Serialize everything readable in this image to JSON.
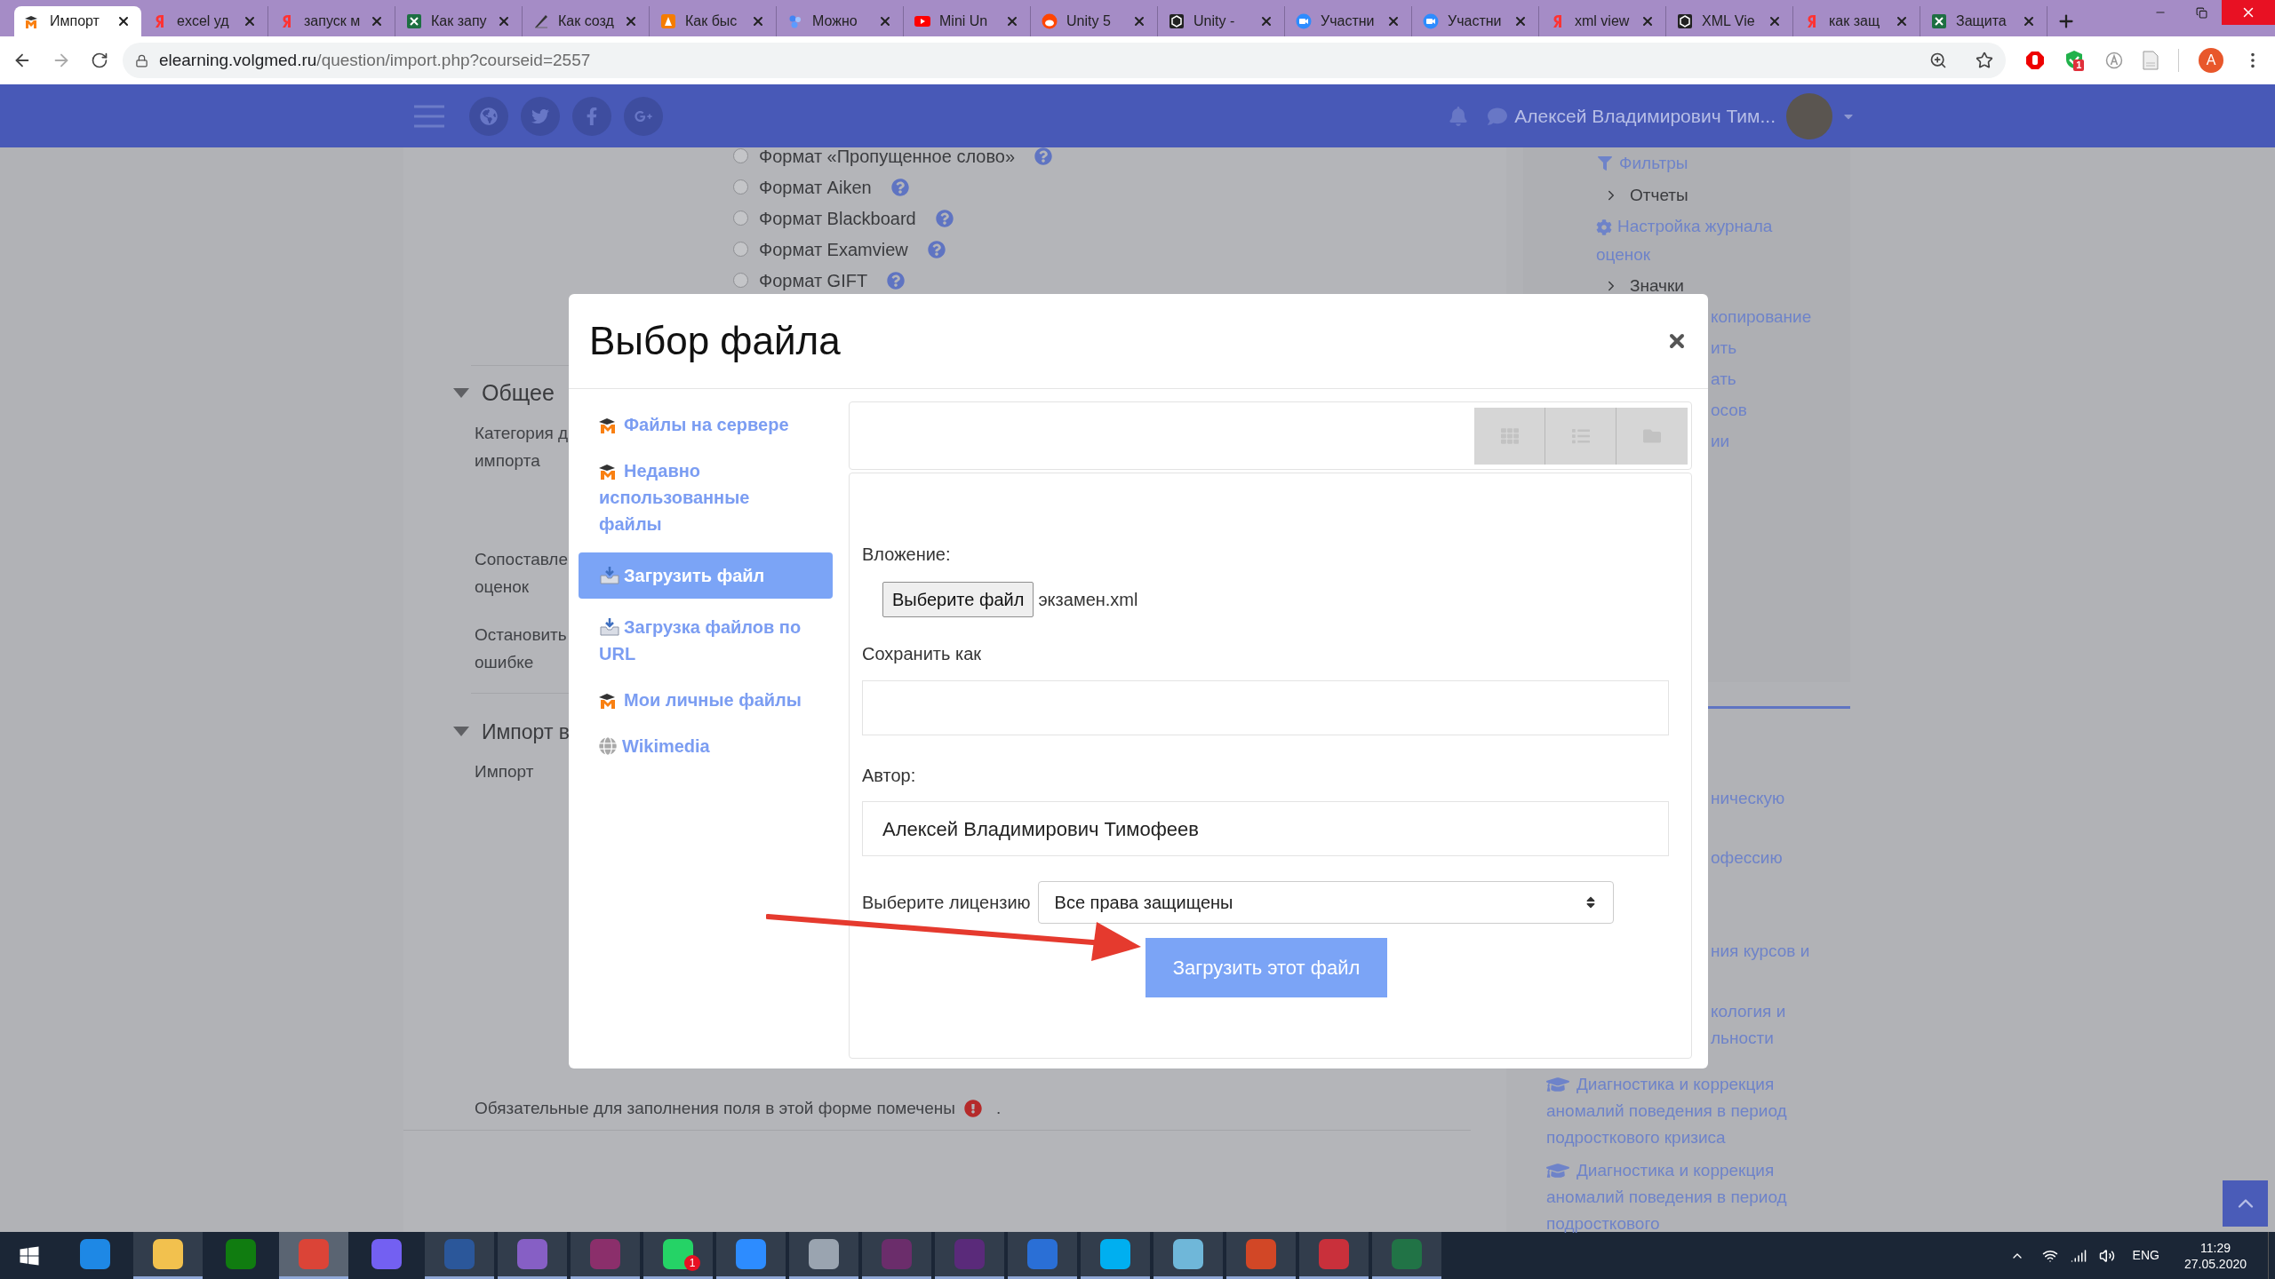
{
  "browser": {
    "tabs": [
      {
        "title": "Импорт",
        "kind": "cap",
        "selected": true
      },
      {
        "title": "excel уд",
        "kind": "letter",
        "selected": false
      },
      {
        "title": "запуск м",
        "kind": "letter",
        "selected": false
      },
      {
        "title": "Как запу",
        "kind": "sheet",
        "selected": false
      },
      {
        "title": "Как созд",
        "kind": "pen",
        "selected": false
      },
      {
        "title": "Как быс",
        "kind": "triangle",
        "selected": false
      },
      {
        "title": "Можно",
        "kind": "dots",
        "selected": false
      },
      {
        "title": "Mini Un",
        "kind": "play",
        "selected": false
      },
      {
        "title": "Unity 5",
        "kind": "alien",
        "selected": false
      },
      {
        "title": "Unity -",
        "kind": "cube",
        "selected": false
      },
      {
        "title": "Участни",
        "kind": "camera",
        "selected": false
      },
      {
        "title": "Участни",
        "kind": "camera",
        "selected": false
      },
      {
        "title": "xml view",
        "kind": "letter",
        "selected": false
      },
      {
        "title": "XML Vie",
        "kind": "cube",
        "selected": false
      },
      {
        "title": "как защ",
        "kind": "letter",
        "selected": false
      },
      {
        "title": "Защита",
        "kind": "sheet",
        "selected": false
      }
    ],
    "url_host": "elearning.volgmed.ru",
    "url_path": "/question/import.php?courseid=2557",
    "extension_badge": "1",
    "profile_initial": "A"
  },
  "navbar": {
    "user_name": "Алексей Владимирович Тим..."
  },
  "page": {
    "formats": [
      {
        "label": "Формат «Пропущенное слово»",
        "selected": false
      },
      {
        "label": "Формат Aiken",
        "selected": false
      },
      {
        "label": "Формат Blackboard",
        "selected": false
      },
      {
        "label": "Формат Examview",
        "selected": false
      },
      {
        "label": "Формат GIFT",
        "selected": false
      }
    ],
    "section_general": "Общее",
    "fields": [
      [
        "Категория д",
        "импорта"
      ],
      [
        "Сопоставле",
        "оценок"
      ],
      [
        "Остановить",
        "ошибке"
      ]
    ],
    "section_import": "Импорт в",
    "import_label": "Импорт",
    "required_note": "Обязательные для заполнения поля в этой форме помечены",
    "required_note_end": "."
  },
  "sidebar": {
    "items": [
      {
        "kind": "filter",
        "text": "Фильтры"
      },
      {
        "kind": "chevron",
        "text": "Отчеты"
      },
      {
        "kind": "gear",
        "lines": [
          "Настройка журнала",
          "оценок"
        ]
      },
      {
        "kind": "chevron",
        "text": "Значки"
      },
      {
        "kind": "fragment",
        "text": "копирование"
      },
      {
        "kind": "fragment",
        "text": "ить"
      },
      {
        "kind": "fragment",
        "text": "ать"
      },
      {
        "kind": "fragment",
        "text": "осов"
      },
      {
        "kind": "fragment",
        "text": "ии"
      }
    ],
    "courses": [
      {
        "kind": "fragment",
        "lines": [
          "ническую"
        ]
      },
      {
        "kind": "fragment",
        "lines": [
          "офессию"
        ]
      },
      {
        "kind": "fragment",
        "lines": [
          "ния курсов и"
        ]
      },
      {
        "kind": "fragment",
        "lines": [
          "кология и",
          "льности"
        ]
      },
      {
        "kind": "course",
        "lines": [
          "Диагностика и коррекция",
          "аномалий поведения в период",
          "подросткового кризиса"
        ]
      },
      {
        "kind": "course",
        "lines": [
          "Диагностика и коррекция",
          "аномалий поведения в период",
          "подросткового"
        ]
      }
    ]
  },
  "modal": {
    "title": "Выбор файла",
    "nav": [
      {
        "text": "Файлы на сервере",
        "kind": "cap",
        "selected": false
      },
      {
        "text": "Недавно использованные файлы",
        "kind": "cap",
        "selected": false
      },
      {
        "text": "Загрузить файл",
        "kind": "tray",
        "selected": true
      },
      {
        "text": "Загрузка файлов по URL",
        "kind": "tray",
        "selected": false
      },
      {
        "text": "Мои личные файлы",
        "kind": "cap",
        "selected": false
      },
      {
        "text": "Wikimedia",
        "kind": "globe",
        "selected": false
      }
    ],
    "attachment_label": "Вложение:",
    "choose_button": "Выберите файл",
    "chosen_file": "экзамен.xml",
    "save_as_label": "Сохранить как",
    "author_label": "Автор:",
    "author_value": "Алексей Владимирович Тимофеев",
    "license_label": "Выберите лицензию",
    "license_value": "Все права защищены",
    "upload_button": "Загрузить этот файл"
  },
  "taskbar": {
    "apps": [
      {
        "color": "#1e88e5",
        "open": false,
        "selected": false
      },
      {
        "color": "#f2c14e",
        "open": true,
        "selected": false
      },
      {
        "color": "#107c10",
        "open": false,
        "selected": false
      },
      {
        "color": "#db4437",
        "open": true,
        "selected": true
      },
      {
        "color": "#7360f2",
        "open": false,
        "selected": false
      },
      {
        "color": "#2b579a",
        "open": true,
        "selected": false
      },
      {
        "color": "#865fc5",
        "open": true,
        "selected": false
      },
      {
        "color": "#8b2f6b",
        "open": true,
        "selected": false
      },
      {
        "color": "#25d366",
        "open": true,
        "selected": false,
        "badge": "1"
      },
      {
        "color": "#2d8cff",
        "open": true,
        "selected": false
      },
      {
        "color": "#9aa4b0",
        "open": true,
        "selected": false
      },
      {
        "color": "#6b2d6b",
        "open": true,
        "selected": false
      },
      {
        "color": "#5a2a7a",
        "open": true,
        "selected": false
      },
      {
        "color": "#2a6fd6",
        "open": true,
        "selected": false
      },
      {
        "color": "#00aff0",
        "open": true,
        "selected": false
      },
      {
        "color": "#6fb7d9",
        "open": true,
        "selected": false
      },
      {
        "color": "#d24726",
        "open": true,
        "selected": false
      },
      {
        "color": "#c9303b",
        "open": true,
        "selected": false
      },
      {
        "color": "#217346",
        "open": true,
        "selected": false
      }
    ],
    "language": "ENG",
    "time": "11:29",
    "date": "27.05.2020"
  }
}
